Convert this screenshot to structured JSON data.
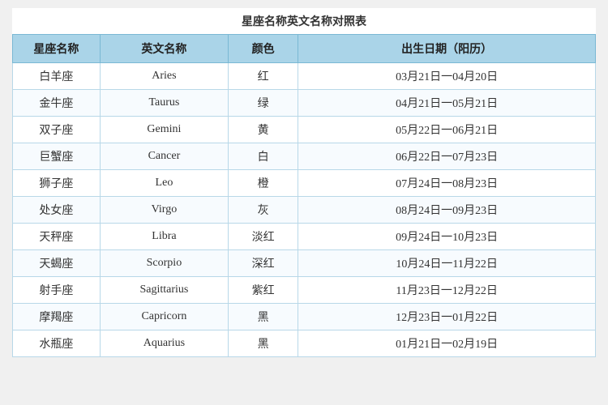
{
  "title": "星座名称英文名称对照表",
  "headers": {
    "cn_name": "星座名称",
    "en_name": "英文名称",
    "color": "颜色",
    "date": "出生日期（阳历）"
  },
  "rows": [
    {
      "cn": "白羊座",
      "en": "Aries",
      "color": "红",
      "date": "03月21日一04月20日"
    },
    {
      "cn": "金牛座",
      "en": "Taurus",
      "color": "绿",
      "date": "04月21日一05月21日"
    },
    {
      "cn": "双子座",
      "en": "Gemini",
      "color": "黄",
      "date": "05月22日一06月21日"
    },
    {
      "cn": "巨蟹座",
      "en": "Cancer",
      "color": "白",
      "date": "06月22日一07月23日"
    },
    {
      "cn": "狮子座",
      "en": "Leo",
      "color": "橙",
      "date": "07月24日一08月23日"
    },
    {
      "cn": "处女座",
      "en": "Virgo",
      "color": "灰",
      "date": "08月24日一09月23日"
    },
    {
      "cn": "天秤座",
      "en": "Libra",
      "color": "淡红",
      "date": "09月24日一10月23日"
    },
    {
      "cn": "天蝎座",
      "en": "Scorpio",
      "color": "深红",
      "date": "10月24日一11月22日"
    },
    {
      "cn": "射手座",
      "en": "Sagittarius",
      "color": "紫红",
      "date": "11月23日一12月22日"
    },
    {
      "cn": "摩羯座",
      "en": "Capricorn",
      "color": "黑",
      "date": "12月23日一01月22日"
    },
    {
      "cn": "水瓶座",
      "en": "Aquarius",
      "color": "黑",
      "date": "01月21日一02月19日"
    }
  ]
}
